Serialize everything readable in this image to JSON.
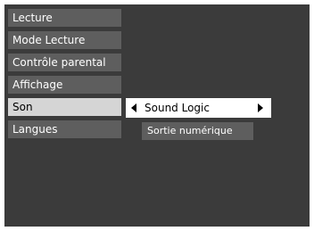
{
  "menu": {
    "items": [
      {
        "label": "Lecture"
      },
      {
        "label": "Mode Lecture"
      },
      {
        "label": "Contrôle parental"
      },
      {
        "label": "Affichage"
      },
      {
        "label": "Son",
        "selected": true
      },
      {
        "label": "Langues"
      }
    ]
  },
  "submenu": {
    "selected_option": "Sound Logic",
    "next_item": "Sortie numérique"
  },
  "colors": {
    "background": "#3b3b3b",
    "item": "#5e5e5e",
    "selected_item": "#d5d5d5",
    "highlight": "#ffffff"
  },
  "icons": {
    "left": "triangle-left-icon",
    "right": "triangle-right-icon"
  }
}
